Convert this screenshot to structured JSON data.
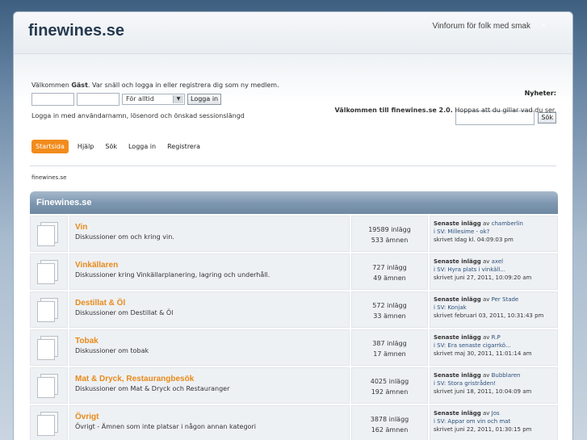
{
  "header": {
    "site_title": "finewines.se",
    "tagline": "Vinforum för folk med smak",
    "collapse_icon": "chevron-up-icon"
  },
  "userbar": {
    "welcome_prefix": "Välkommen",
    "guest": "Gäst",
    "welcome_suffix": ". Var snäll och logga in eller registrera dig som ny medlem.",
    "username_value": "",
    "password_value": "",
    "duration_selected": "För alltid",
    "login_button": "Logga in",
    "login_hint": "Logga in med användarnamn, lösenord och önskad sessionslängd",
    "search_value": "",
    "search_button": "Sök",
    "news_label": "Nyheter:",
    "news_bold": "Välkommen till finewines.se 2.0.",
    "news_rest": " Hoppas att du gillar vad du ser."
  },
  "nav": {
    "items": [
      "Startsida",
      "Hjälp",
      "Sök",
      "Logga in",
      "Registrera"
    ]
  },
  "breadcrumb": "finewines.se",
  "category": {
    "title": "Finewines.se",
    "boards": [
      {
        "name": "Vin",
        "description": "Diskussioner om och kring vin.",
        "posts": "19589 inlägg",
        "topics": "533 ämnen",
        "last_label": "Senaste inlägg",
        "last_by": " av ",
        "last_user": "chamberlin",
        "last_topic": "i SV: Millesime - ok?",
        "last_time": "skrivet Idag kl. 04:09:03 pm"
      },
      {
        "name": "Vinkällaren",
        "description": "Diskussioner kring Vinkällarplanering, lagring och underhåll.",
        "posts": "727 inlägg",
        "topics": "49 ämnen",
        "last_label": "Senaste inlägg",
        "last_by": " av ",
        "last_user": "axel",
        "last_topic": "i SV: Hyra plats i vinkäll...",
        "last_time": "skrivet juni 27, 2011, 10:09:20 am"
      },
      {
        "name": "Destillat & Öl",
        "description": "Diskussioner om Destillat & Öl",
        "posts": "572 inlägg",
        "topics": "33 ämnen",
        "last_label": "Senaste inlägg",
        "last_by": " av ",
        "last_user": "Per Stade",
        "last_topic": "i SV: Konjak",
        "last_time": "skrivet februari 03, 2011, 10:31:43 pm"
      },
      {
        "name": "Tobak",
        "description": "Diskussioner om tobak",
        "posts": "387 inlägg",
        "topics": "17 ämnen",
        "last_label": "Senaste inlägg",
        "last_by": " av ",
        "last_user": "R.P",
        "last_topic": "i SV: Era senaste cigarrkö...",
        "last_time": "skrivet maj 30, 2011, 11:01:14 am"
      },
      {
        "name": "Mat & Dryck, Restaurangbesök",
        "description": "Diskussioner om Mat & Dryck och Restauranger",
        "posts": "4025 inlägg",
        "topics": "192 ämnen",
        "last_label": "Senaste inlägg",
        "last_by": " av ",
        "last_user": "Bubblaren",
        "last_topic": "i SV: Stora gristråden!",
        "last_time": "skrivet juni 18, 2011, 10:04:09 am"
      },
      {
        "name": "Övrigt",
        "description": "Övrigt - Ämnen som inte platsar i någon annan kategori",
        "posts": "3878 inlägg",
        "topics": "162 ämnen",
        "last_label": "Senaste inlägg",
        "last_by": " av ",
        "last_user": "Jos",
        "last_topic": "i SV: Appar om vin och mat",
        "last_time": "skrivet juni 22, 2011, 01:30:15 pm"
      }
    ]
  }
}
